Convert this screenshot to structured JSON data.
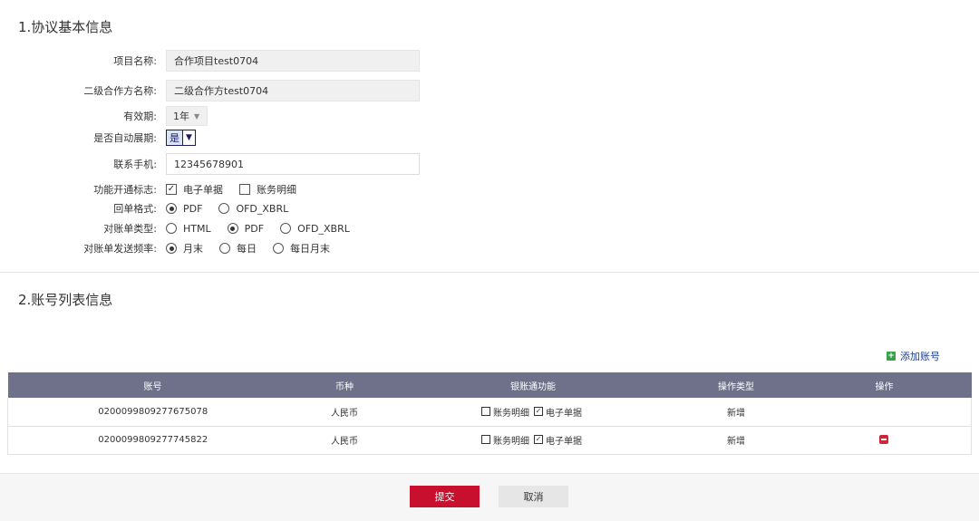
{
  "section1": {
    "title": "1.协议基本信息"
  },
  "form": {
    "project_name": {
      "label": "项目名称:",
      "value": "合作项目test0704"
    },
    "secondary_partner": {
      "label": "二级合作方名称:",
      "value": "二级合作方test0704"
    },
    "validity": {
      "label": "有效期:",
      "value": "1年"
    },
    "auto_renew": {
      "label": "是否自动展期:",
      "value": "是"
    },
    "phone": {
      "label": "联系手机:",
      "value": "12345678901"
    },
    "features": {
      "label": "功能开通标志:",
      "options": [
        {
          "label": "电子单据",
          "checked": true
        },
        {
          "label": "账务明细",
          "checked": false
        }
      ]
    },
    "receipt_format": {
      "label": "回单格式:",
      "options": [
        {
          "label": "PDF",
          "selected": true
        },
        {
          "label": "OFD_XBRL",
          "selected": false
        }
      ]
    },
    "statement_type": {
      "label": "对账单类型:",
      "options": [
        {
          "label": "HTML",
          "selected": false
        },
        {
          "label": "PDF",
          "selected": true
        },
        {
          "label": "OFD_XBRL",
          "selected": false
        }
      ]
    },
    "send_frequency": {
      "label": "对账单发送频率:",
      "options": [
        {
          "label": "月末",
          "selected": true
        },
        {
          "label": "每日",
          "selected": false
        },
        {
          "label": "每日月末",
          "selected": false
        }
      ]
    }
  },
  "section2": {
    "title": "2.账号列表信息",
    "add_label": "添加账号"
  },
  "table": {
    "headers": [
      "账号",
      "币种",
      "银账通功能",
      "操作类型",
      "操作"
    ],
    "rows": [
      {
        "account": "0200099809277675078",
        "currency": "人民币",
        "func1": "账务明细",
        "func1_checked": false,
        "func2": "电子单据",
        "func2_checked": true,
        "op_type": "新增",
        "has_delete": false
      },
      {
        "account": "0200099809277745822",
        "currency": "人民币",
        "func1": "账务明细",
        "func1_checked": false,
        "func2": "电子单据",
        "func2_checked": true,
        "op_type": "新增",
        "has_delete": true
      }
    ]
  },
  "buttons": {
    "submit": "提交",
    "cancel": "取消"
  },
  "colors": {
    "header_bg": "#6e7189",
    "submit_bg": "#c8102e",
    "add_icon": "#3aa14a",
    "link": "#1d3f8f"
  },
  "icons": {
    "add": "plus-square-icon",
    "delete": "minus-square-icon",
    "check": "check-icon",
    "dropdown": "caret-down-icon"
  }
}
